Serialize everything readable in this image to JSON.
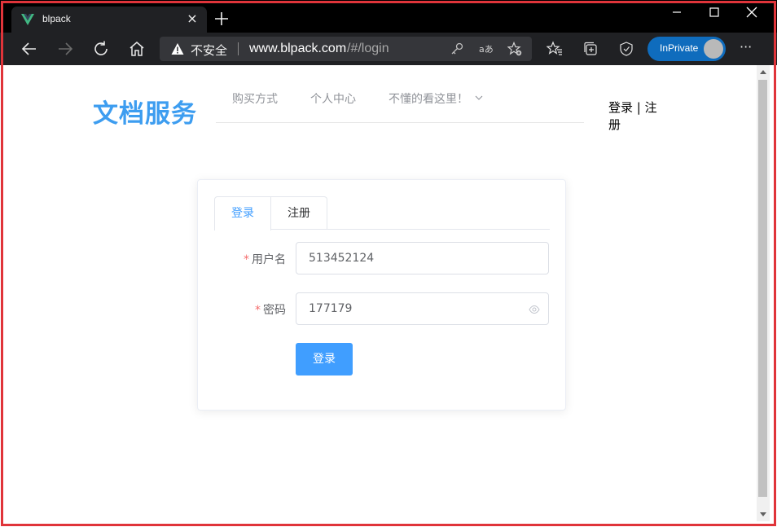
{
  "browser": {
    "tab_title": "blpack",
    "tab_close": "×",
    "security_label": "不安全",
    "url_host": "www.blpack.com",
    "url_path": "/#/login",
    "inprivate_label": "InPrivate",
    "more_label": "···",
    "colors": {
      "frame": "#202124",
      "accent": "#0f6cbd"
    }
  },
  "page": {
    "logo": "文档服务",
    "nav_items": [
      "购买方式",
      "个人中心",
      "不懂的看这里！"
    ],
    "auth_links": "登录 | 注册"
  },
  "login_card": {
    "tabs": [
      "登录",
      "注册"
    ],
    "active_tab": "登录",
    "username_label": "用户名",
    "username_value": "513452124",
    "password_label": "密码",
    "password_value": "177179",
    "required_mark": "*",
    "submit_label": "登录",
    "colors": {
      "primary": "#409eff",
      "required": "#f56c6c"
    }
  }
}
